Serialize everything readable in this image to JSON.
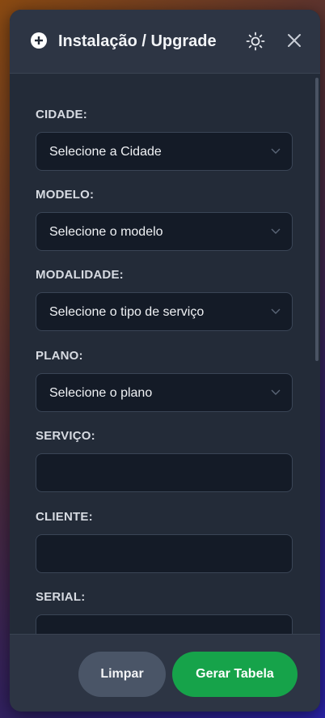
{
  "header": {
    "title": "Instalação / Upgrade",
    "icons": {
      "add": "plus-circle-icon",
      "theme": "sun-icon",
      "close": "close-icon"
    }
  },
  "form": {
    "cidade": {
      "label": "CIDADE:",
      "value": "Selecione a Cidade"
    },
    "modelo": {
      "label": "MODELO:",
      "value": "Selecione o modelo"
    },
    "modalidade": {
      "label": "MODALIDADE:",
      "value": "Selecione o tipo de serviço"
    },
    "plano": {
      "label": "PLANO:",
      "value": "Selecione o plano"
    },
    "servico": {
      "label": "SERVIÇO:",
      "value": ""
    },
    "cliente": {
      "label": "CLIENTE:",
      "value": ""
    },
    "serial": {
      "label": "SERIAL:",
      "value": ""
    }
  },
  "footer": {
    "clear_label": "Limpar",
    "generate_label": "Gerar Tabela"
  },
  "colors": {
    "panel": "#232b38",
    "header": "#2d3544",
    "input_bg": "#141b27",
    "primary": "#16a34a",
    "secondary": "#4a5567"
  }
}
